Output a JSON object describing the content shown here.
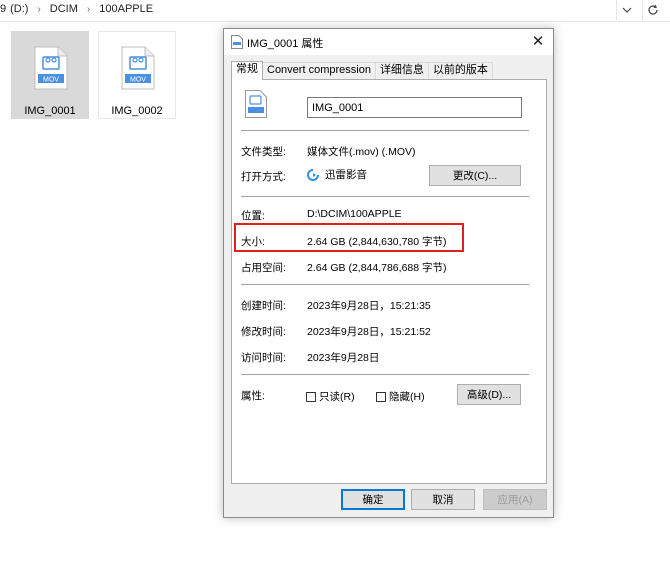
{
  "explorer": {
    "breadcrumbs": [
      "(D:)",
      "DCIM",
      "100APPLE"
    ],
    "breadcrumb_prefix": "9",
    "nav_buttons": [
      "chevron-down-icon",
      "refresh-icon"
    ],
    "files": [
      {
        "name": "IMG_0001",
        "badge": "MOV",
        "selected": true
      },
      {
        "name": "IMG_0002",
        "badge": "MOV",
        "selected": false
      }
    ]
  },
  "dialog": {
    "title": "IMG_0001 属性",
    "close_glyph": "✕",
    "tabs": [
      "常规",
      "Convert compression",
      "详细信息",
      "以前的版本"
    ],
    "active_tab": 0,
    "filename": "IMG_0001",
    "rows": {
      "type_label": "文件类型:",
      "type_value": "媒体文件(.mov) (.MOV)",
      "opens_label": "打开方式:",
      "opens_value": "迅雷影音",
      "change_button": "更改(C)...",
      "location_label": "位置:",
      "location_value": "D:\\DCIM\\100APPLE",
      "size_label": "大小:",
      "size_value": "2.64 GB (2,844,630,780 字节)",
      "disk_label": "占用空间:",
      "disk_value": "2.64 GB (2,844,786,688 字节)",
      "created_label": "创建时间:",
      "created_value": "2023年9月28日，15:21:35",
      "modified_label": "修改时间:",
      "modified_value": "2023年9月28日，15:21:52",
      "accessed_label": "访问时间:",
      "accessed_value": "2023年9月28日",
      "attr_label": "属性:",
      "readonly_label": "只读(R)",
      "readonly_checked": false,
      "hidden_label": "隐藏(H)",
      "hidden_checked": false,
      "advanced_button": "高级(D)..."
    },
    "footer": {
      "ok": "确定",
      "cancel": "取消",
      "apply": "应用(A)"
    },
    "colors": {
      "highlight_box": "#e02020",
      "file_icon_blue": "#4a90e2"
    }
  }
}
